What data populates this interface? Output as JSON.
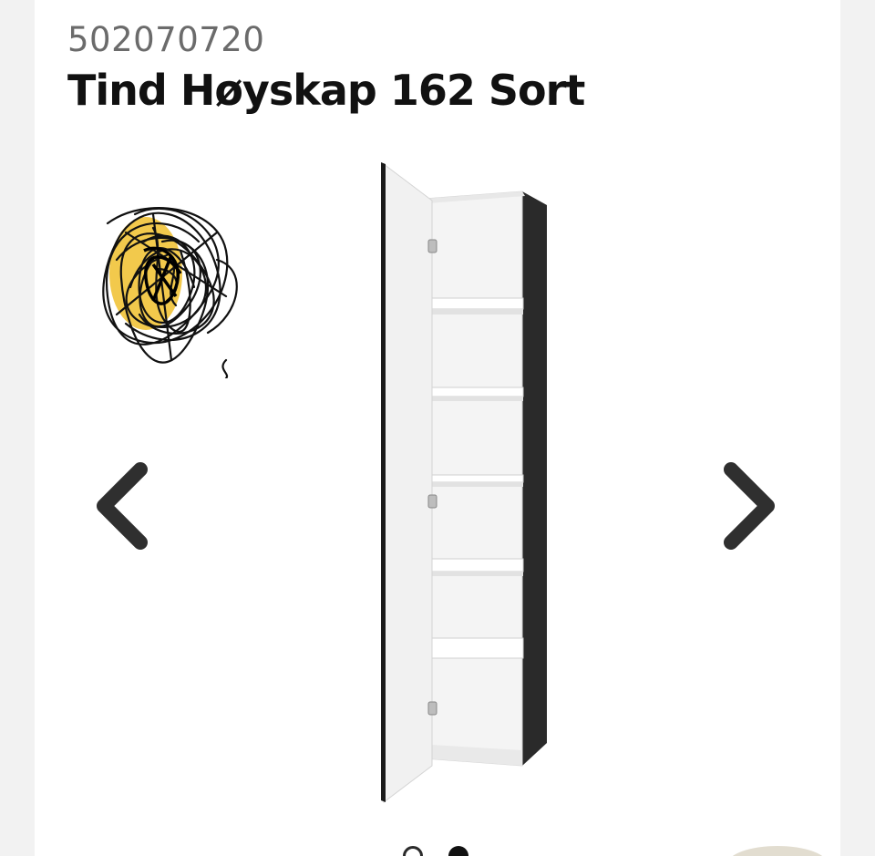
{
  "product": {
    "article_number": "502070720",
    "title": "Tind Høyskap 162 Sort"
  },
  "gallery": {
    "prev_icon": "chevron-left-icon",
    "next_icon": "chevron-right-icon",
    "total_slides": 2,
    "active_slide": 2
  },
  "colors": {
    "cabinet_body": "#2a2a2a",
    "cabinet_interior": "#f4f4f4",
    "badge_yellow": "#f2c94c",
    "text_primary": "#111111",
    "text_secondary": "#6b6b6b"
  }
}
